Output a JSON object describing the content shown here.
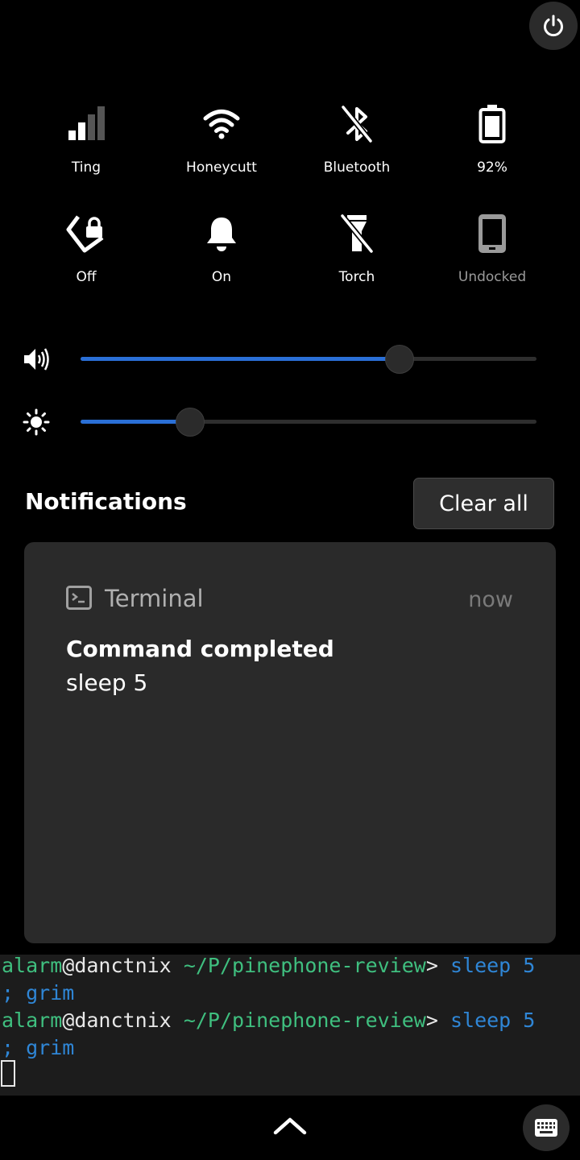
{
  "quick_settings": {
    "tiles": [
      {
        "label": "Ting",
        "icon": "cellular-signal-icon"
      },
      {
        "label": "Honeycutt",
        "icon": "wifi-icon"
      },
      {
        "label": "Bluetooth",
        "icon": "bluetooth-disabled-icon"
      },
      {
        "label": "92%",
        "icon": "battery-icon"
      },
      {
        "label": "Off",
        "icon": "rotation-lock-icon"
      },
      {
        "label": "On",
        "icon": "notifications-bell-icon"
      },
      {
        "label": "Torch",
        "icon": "torch-off-icon"
      },
      {
        "label": "Undocked",
        "icon": "phone-docked-icon"
      }
    ]
  },
  "sliders": {
    "volume": {
      "icon": "volume-high-icon",
      "value": 0.7
    },
    "brightness": {
      "icon": "brightness-icon",
      "value": 0.24
    }
  },
  "notifications": {
    "heading": "Notifications",
    "clear_label": "Clear all",
    "card": {
      "app_name": "Terminal",
      "time": "now",
      "summary": "Command completed",
      "body": "sleep 5"
    }
  },
  "terminal": {
    "prompt_user": "alarm",
    "prompt_at": "@",
    "prompt_host": "danctnix",
    "prompt_path": "~/P/pinephone-review",
    "prompt_symbol": ">",
    "command_part1": "sleep 5",
    "command_part2": "; grim"
  },
  "colors": {
    "accent": "#2a6fd6",
    "term_green": "#3fbf7f",
    "term_blue": "#2f86d6"
  }
}
